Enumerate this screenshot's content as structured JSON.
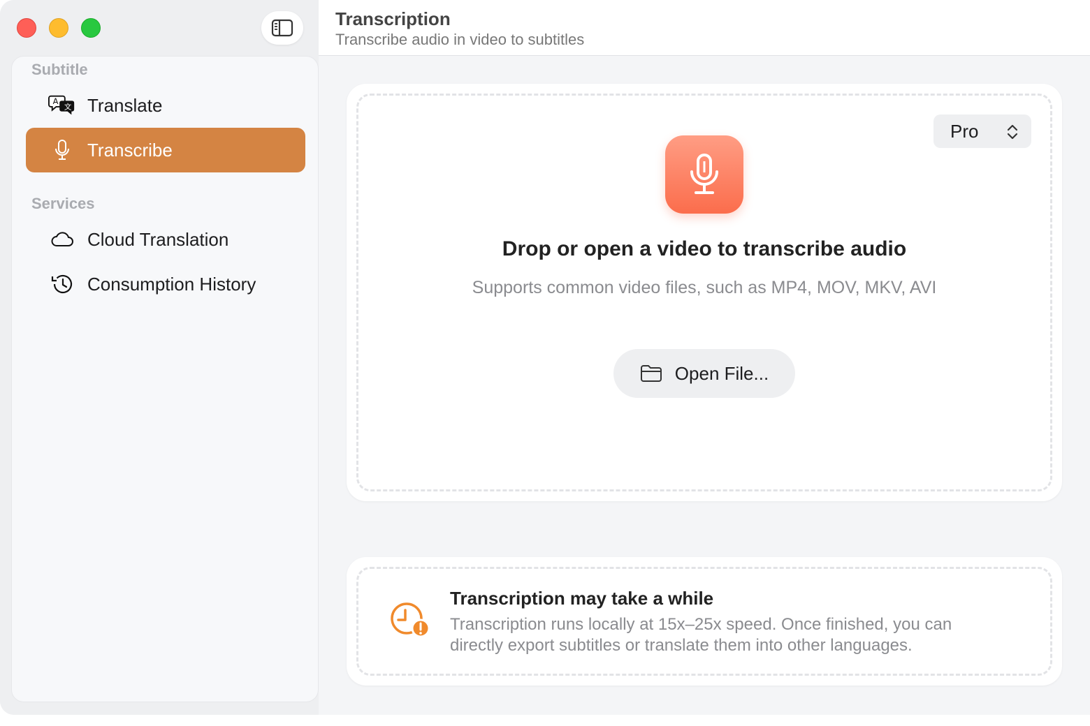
{
  "window": {
    "controls": [
      "close",
      "minimize",
      "zoom"
    ]
  },
  "sidebar": {
    "toggle_icon": "sidebar-left-icon",
    "sections": [
      {
        "label": "Subtitle",
        "items": [
          {
            "label": "Translate",
            "icon": "translate-bubbles-icon",
            "active": false
          },
          {
            "label": "Transcribe",
            "icon": "microphone-icon",
            "active": true
          }
        ]
      },
      {
        "label": "Services",
        "items": [
          {
            "label": "Cloud Translation",
            "icon": "cloud-icon",
            "active": false
          },
          {
            "label": "Consumption History",
            "icon": "history-clock-icon",
            "active": false
          }
        ]
      }
    ]
  },
  "header": {
    "title": "Transcription",
    "subtitle": "Transcribe audio in video to subtitles"
  },
  "drop_zone": {
    "model_select": "Pro",
    "title": "Drop or open a video to transcribe audio",
    "subtitle": "Supports common video files, such as MP4, MOV, MKV, AVI",
    "open_button": "Open File..."
  },
  "info": {
    "title": "Transcription may take a while",
    "body": "Transcription runs locally at 15x–25x speed. Once finished, you can directly export subtitles or translate them into other languages."
  },
  "colors": {
    "accent": "#d48443",
    "mic_gradient_top": "#ff9d84",
    "mic_gradient_bottom": "#fb6d4c",
    "warning": "#f08a2c"
  }
}
